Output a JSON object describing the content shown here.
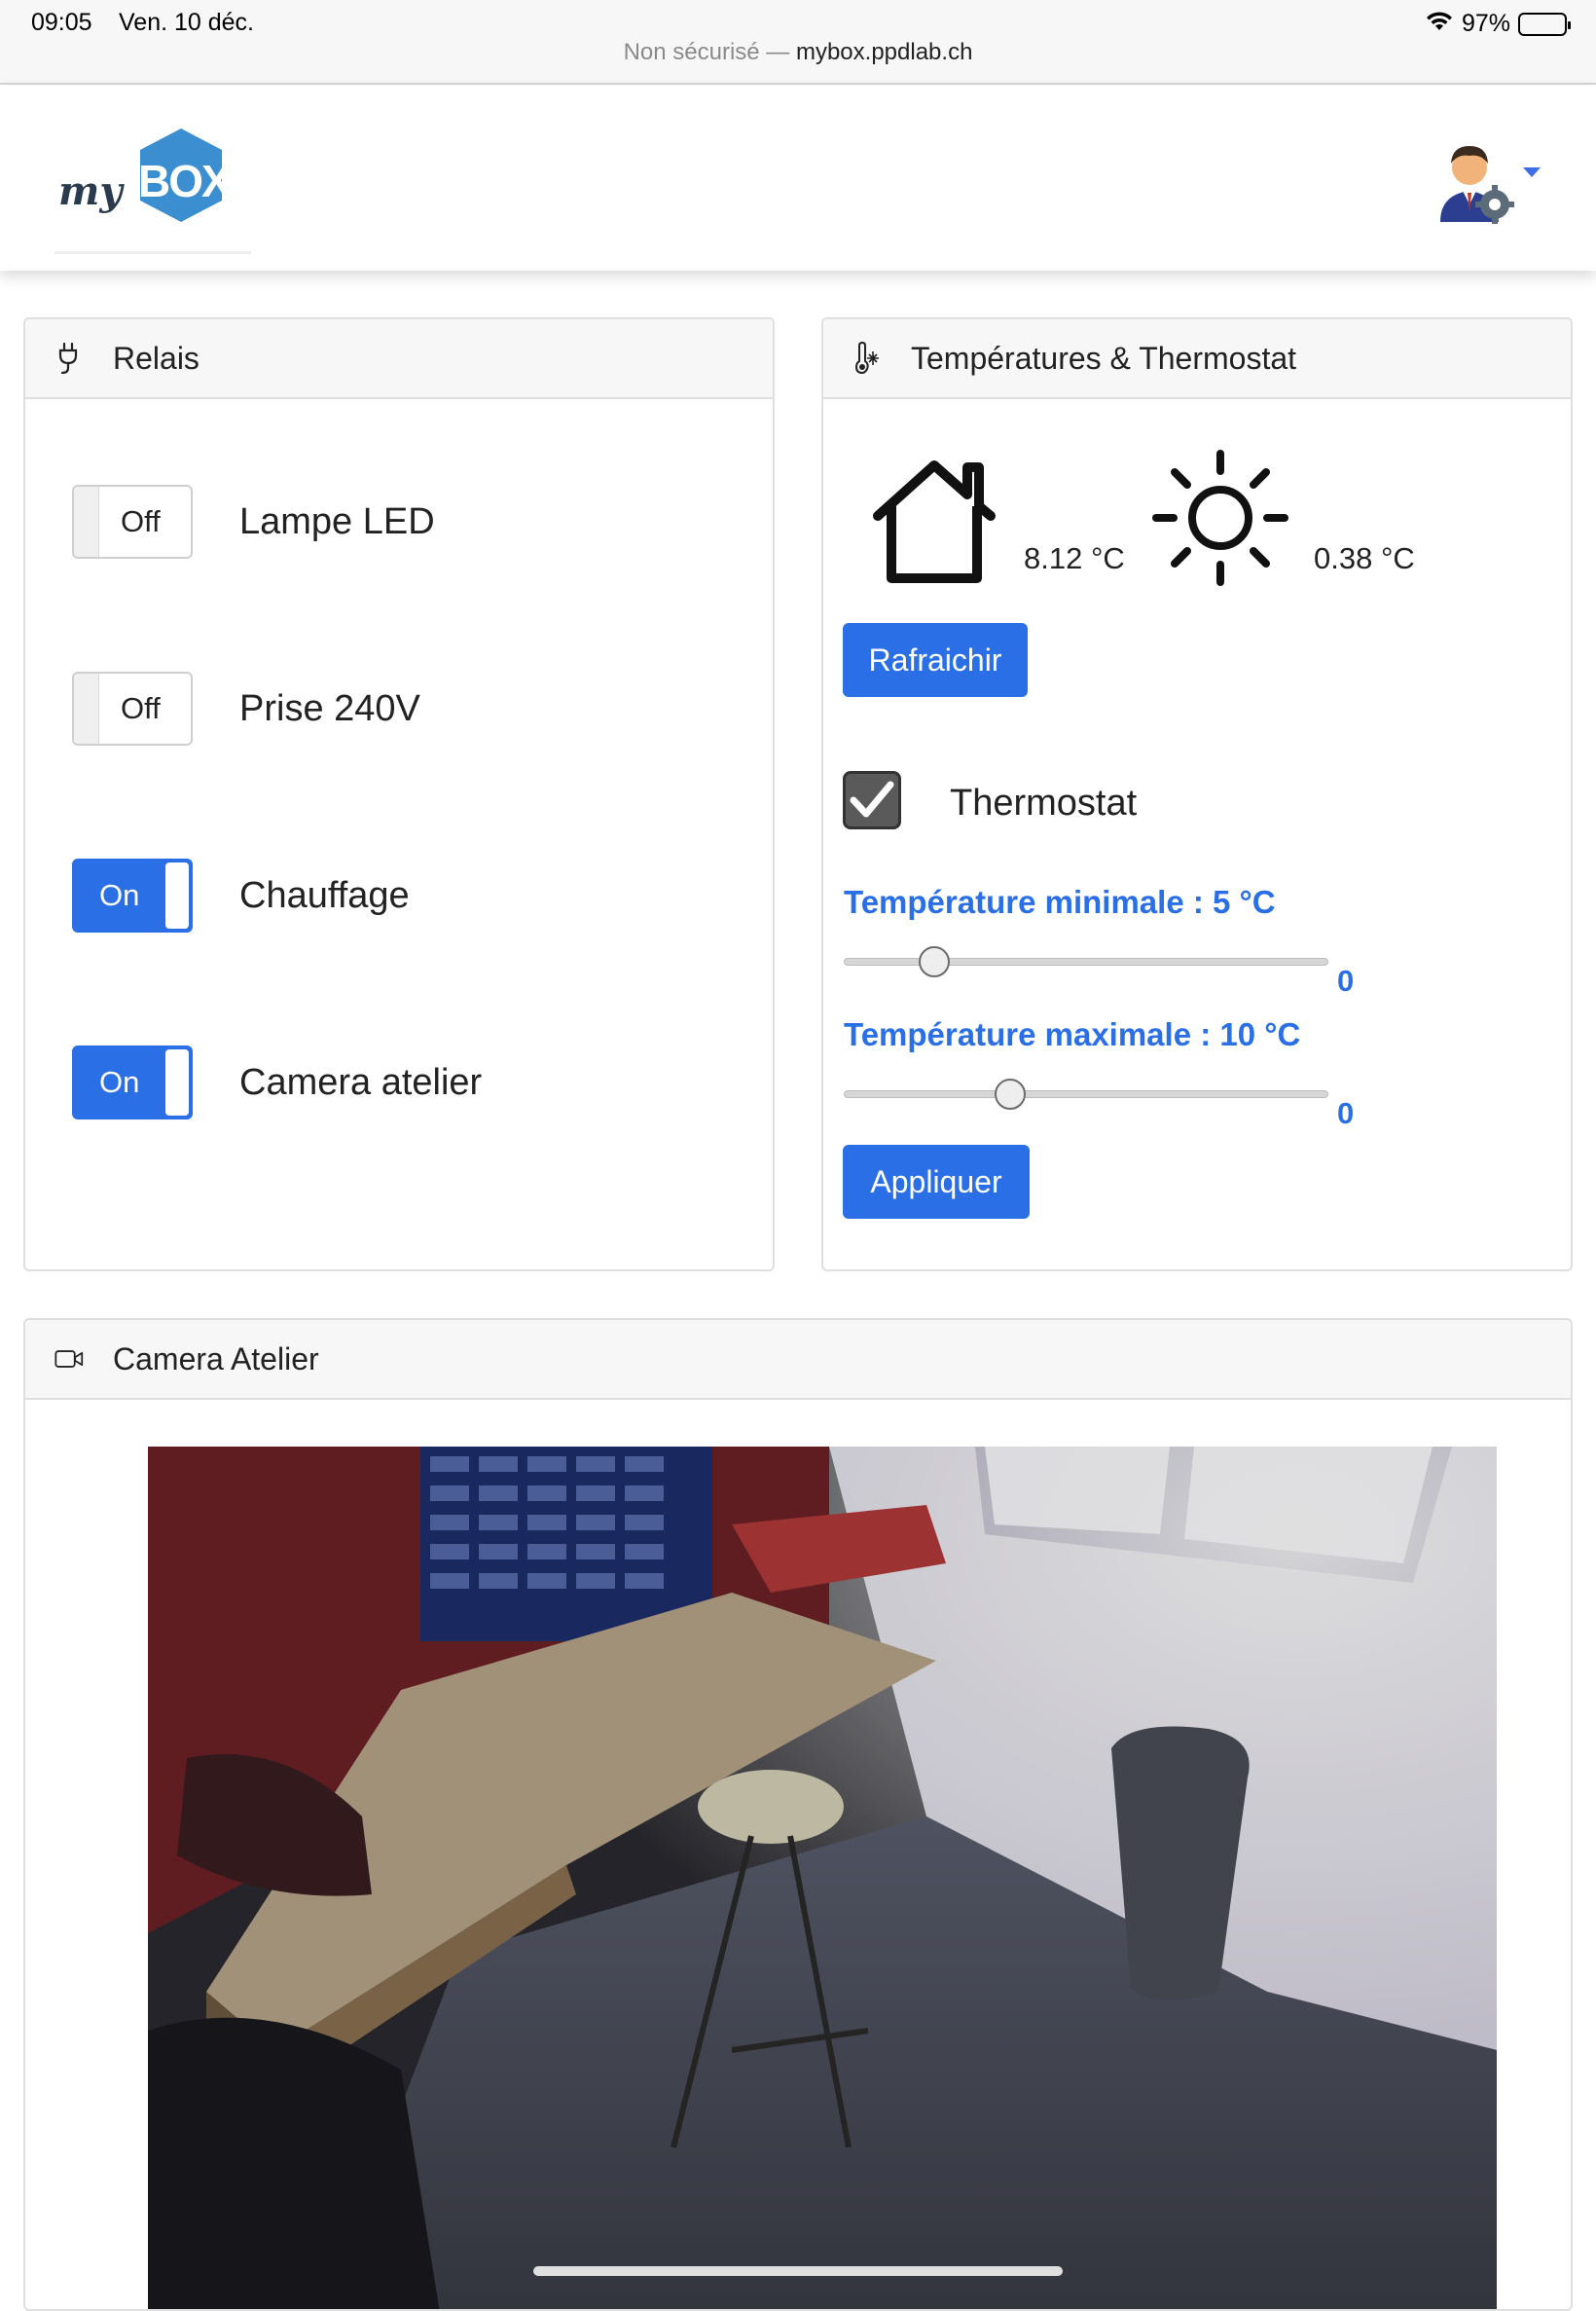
{
  "status_bar": {
    "time": "09:05",
    "date": "Ven. 10 déc.",
    "battery": "97%",
    "battery_level_percent": 97,
    "url_prefix": "Non sécurisé —",
    "url_domain": "mybox.ppdlab.ch",
    "icons": [
      "wifi-icon",
      "battery-icon"
    ]
  },
  "navbar": {
    "logo_text_prefix": "my",
    "logo_text_main": "BOX",
    "logo_color": "#3b8fd0",
    "user_icon": "user-settings-icon"
  },
  "relais": {
    "title": "Relais",
    "icon": "plug-icon",
    "items": [
      {
        "label": "Lampe LED",
        "state": "Off"
      },
      {
        "label": "Prise 240V",
        "state": "Off"
      },
      {
        "label": "Chauffage",
        "state": "On"
      },
      {
        "label": "Camera atelier",
        "state": "On"
      }
    ]
  },
  "temperatures": {
    "title": "Températures & Thermostat",
    "icon": "thermometer-snowflake-icon",
    "indoor_icon": "house-icon",
    "indoor_value": "8.12 °C",
    "outdoor_icon": "sun-icon",
    "outdoor_value": "0.38 °C",
    "refresh_label": "Rafraichir",
    "thermostat_label": "Thermostat",
    "thermostat_checked": true,
    "min_label": "Température minimale : 5 °C",
    "min_output": "0",
    "max_label": "Température maximale : 10 °C",
    "max_output": "0",
    "apply_label": "Appliquer",
    "accent_color": "#2a6fe6"
  },
  "camera": {
    "title": "Camera Atelier",
    "icon": "video-camera-icon"
  }
}
